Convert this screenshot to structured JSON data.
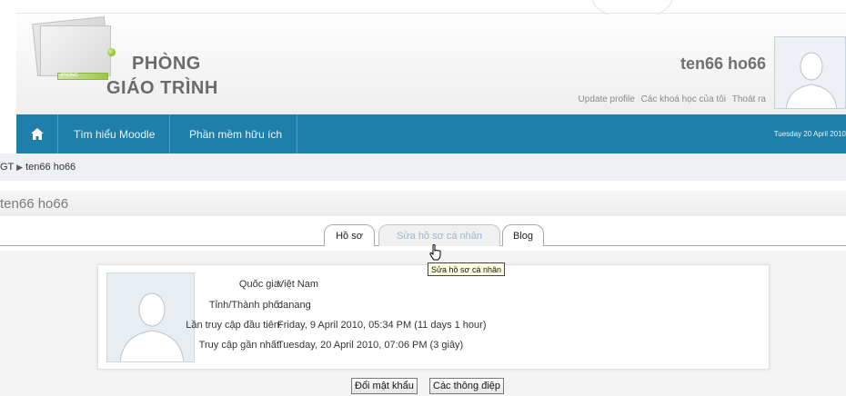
{
  "header": {
    "logo_line1": "PHÒNG",
    "logo_line2": "GIÁO TRÌNH",
    "logo_tag": "PHÒNG",
    "user_name": "ten66 ho66",
    "links": [
      "Update profile",
      "Các khoá học của tôi",
      "Thoát ra"
    ]
  },
  "nav": {
    "home_icon": "home-icon",
    "items": [
      "Tìm hiểu Moodle",
      "Phần mềm hữu ích"
    ],
    "date": "Tuesday 20 April 2010"
  },
  "breadcrumb": {
    "root": "GT",
    "separator": "▶",
    "current": "ten66 ho66"
  },
  "page_title": "ten66 ho66",
  "tabs": [
    {
      "label": "Hồ sơ",
      "active": true
    },
    {
      "label": "Sửa hồ sơ cá nhân",
      "active": false
    },
    {
      "label": "Blog",
      "active": true
    }
  ],
  "tooltip": "Sửa hồ sơ cá nhân",
  "profile": {
    "fields": [
      {
        "label": "Quốc gia:",
        "value": "Việt Nam"
      },
      {
        "label": "Tỉnh/Thành phố:",
        "value": "danang"
      },
      {
        "label": "Lần truy cập đầu tiên:",
        "value": "Friday, 9 April 2010, 05:34 PM  (11 days 1 hour)"
      },
      {
        "label": "Truy cập gần nhất:",
        "value": "Tuesday, 20 April 2010, 07:06 PM  (3 giây)"
      }
    ]
  },
  "buttons": {
    "change_password": "Đổi mật khẩu",
    "messages": "Các thông điệp"
  },
  "colors": {
    "nav_bg": "#1e80aa",
    "breadcrumb_bg": "#eef0f3"
  }
}
